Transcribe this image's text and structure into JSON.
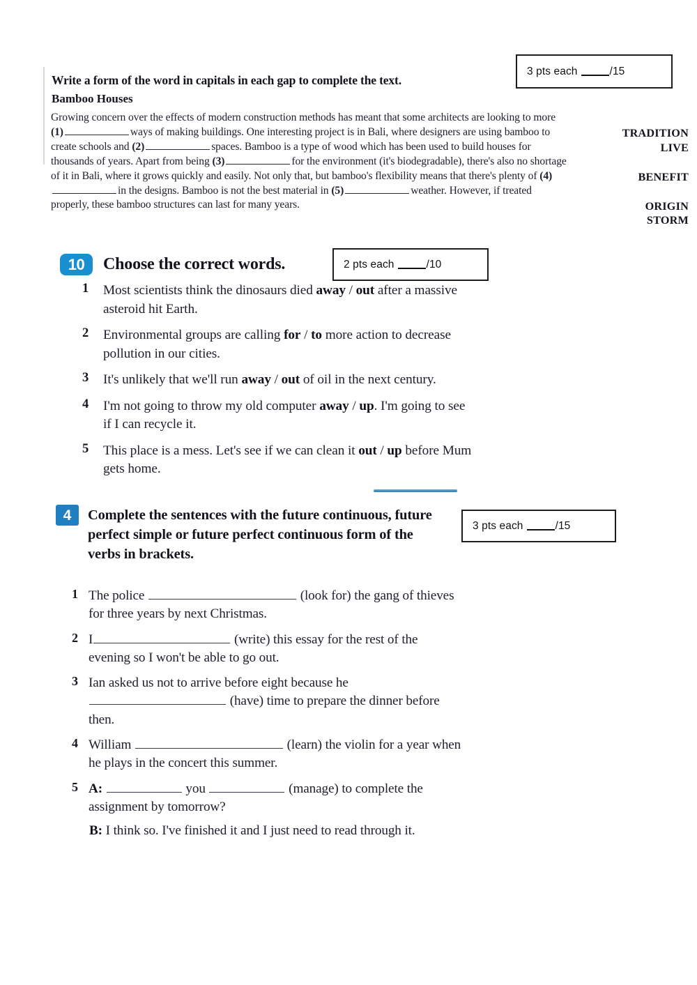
{
  "page": {
    "background_color": "#ffffff",
    "text_color": "#20202e",
    "accent_blue": "#1a8fd0",
    "accent_blue_dark": "#1f7fc0"
  },
  "word_formation": {
    "instruction": "Write a form of the word in capitals in each gap to complete the text.",
    "title": "Bamboo Houses",
    "score_box": {
      "prefix": "3 pts each",
      "total": "/15"
    },
    "text_parts": {
      "p1": "Growing concern over the effects of modern construction methods has meant that some architects are looking to more",
      "n1": "(1)",
      "p2": "ways of making buildings. One interesting project is in Bali, where designers are using bamboo to create schools and",
      "n2": "(2)",
      "p3": "spaces. Bamboo is a type of wood which has been used to build houses for thousands of years. Apart from being",
      "n3": "(3)",
      "p4": "for the environment (it's biodegradable), there's also no shortage of it in Bali, where it grows quickly and easily. Not only that, but bamboo's flexibility means that there's plenty of",
      "n4": "(4)",
      "p5": "in the designs. Bamboo is not the best material in",
      "n5": "(5)",
      "p6": "weather. However, if treated properly, these bamboo structures can last for many years."
    },
    "cues": [
      "TRADITION",
      "LIVE",
      "BENEFIT",
      "ORIGIN",
      "STORM"
    ]
  },
  "exercise_10": {
    "number": "10",
    "heading": "Choose the correct words.",
    "score_box": {
      "prefix": "2 pts each",
      "total": "/10"
    },
    "items": [
      {
        "num": "1",
        "pre": "Most scientists think the dinosaurs died ",
        "opt_a": "away",
        "sep": " / ",
        "opt_b": "out",
        "post": " after a massive asteroid hit Earth."
      },
      {
        "num": "2",
        "pre": "Environmental groups are calling ",
        "opt_a": "for",
        "sep": " / ",
        "opt_b": "to",
        "post": " more action to decrease pollution in our cities."
      },
      {
        "num": "3",
        "pre": "It's unlikely that we'll run ",
        "opt_a": "away",
        "sep": " / ",
        "opt_b": "out",
        "post": " of oil in the next century."
      },
      {
        "num": "4",
        "pre": "I'm not going to throw my old computer ",
        "opt_a": "away",
        "sep": " / ",
        "opt_b": "up",
        "post": ". I'm going to see if I can recycle it."
      },
      {
        "num": "5",
        "pre": "This place is a mess. Let's see if we can clean it ",
        "opt_a": "out",
        "sep": " / ",
        "opt_b": "up",
        "post": " before Mum gets home."
      }
    ]
  },
  "exercise_4": {
    "number": "4",
    "heading": "Complete the sentences with the future continuous, future perfect simple or future perfect continuous form of the verbs in brackets.",
    "score_box": {
      "prefix": "3 pts each",
      "total": "/15"
    },
    "items": [
      {
        "num": "1",
        "pre": "The police ",
        "cue": "(look for)",
        "post": " the gang of thieves for three years by next Christmas."
      },
      {
        "num": "2",
        "pre": "I",
        "cue": "(write)",
        "post": " this essay for the rest of the evening so I won't be able to go out."
      },
      {
        "num": "3",
        "pre": "Ian asked us not to arrive before eight because he ",
        "cue": "(have)",
        "post": " time to prepare the dinner before then."
      },
      {
        "num": "4",
        "pre": "William ",
        "cue": "(learn)",
        "post": " the violin for a year when he plays in the concert this summer."
      },
      {
        "num": "5",
        "speaker_a": "A:",
        "pre": " ",
        "mid": " you ",
        "cue": "(manage)",
        "post": " to complete the assignment by tomorrow?",
        "speaker_b": "B:",
        "reply": " I think so. I've finished it and I just need to read through it."
      }
    ]
  }
}
